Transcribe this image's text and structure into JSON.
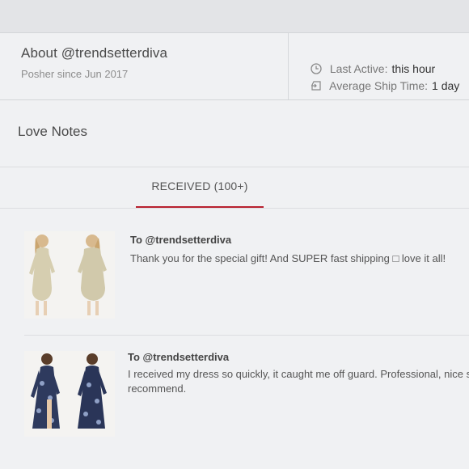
{
  "about": {
    "title": "About @trendsetterdiva",
    "subtitle": "Posher since Jun 2017",
    "last_active_label": "Last Active:",
    "last_active_value": "this hour",
    "ship_label": "Average Ship Time:",
    "ship_value": "1 day",
    "clock_icon": "clock-icon",
    "ship_icon": "shipping-icon"
  },
  "love_notes": {
    "title": "Love Notes",
    "tab_label": "RECEIVED (100+)",
    "accent_color": "#b8202f",
    "notes": [
      {
        "to": "To @trendsetterdiva",
        "text": "Thank you for the special gift! And SUPER fast shipping □ love it all!"
      },
      {
        "to": "To @trendsetterdiva",
        "text_line1": "I received my dress so quickly, it caught me off guard. Professional, nice s",
        "text_line2": "recommend."
      }
    ]
  }
}
